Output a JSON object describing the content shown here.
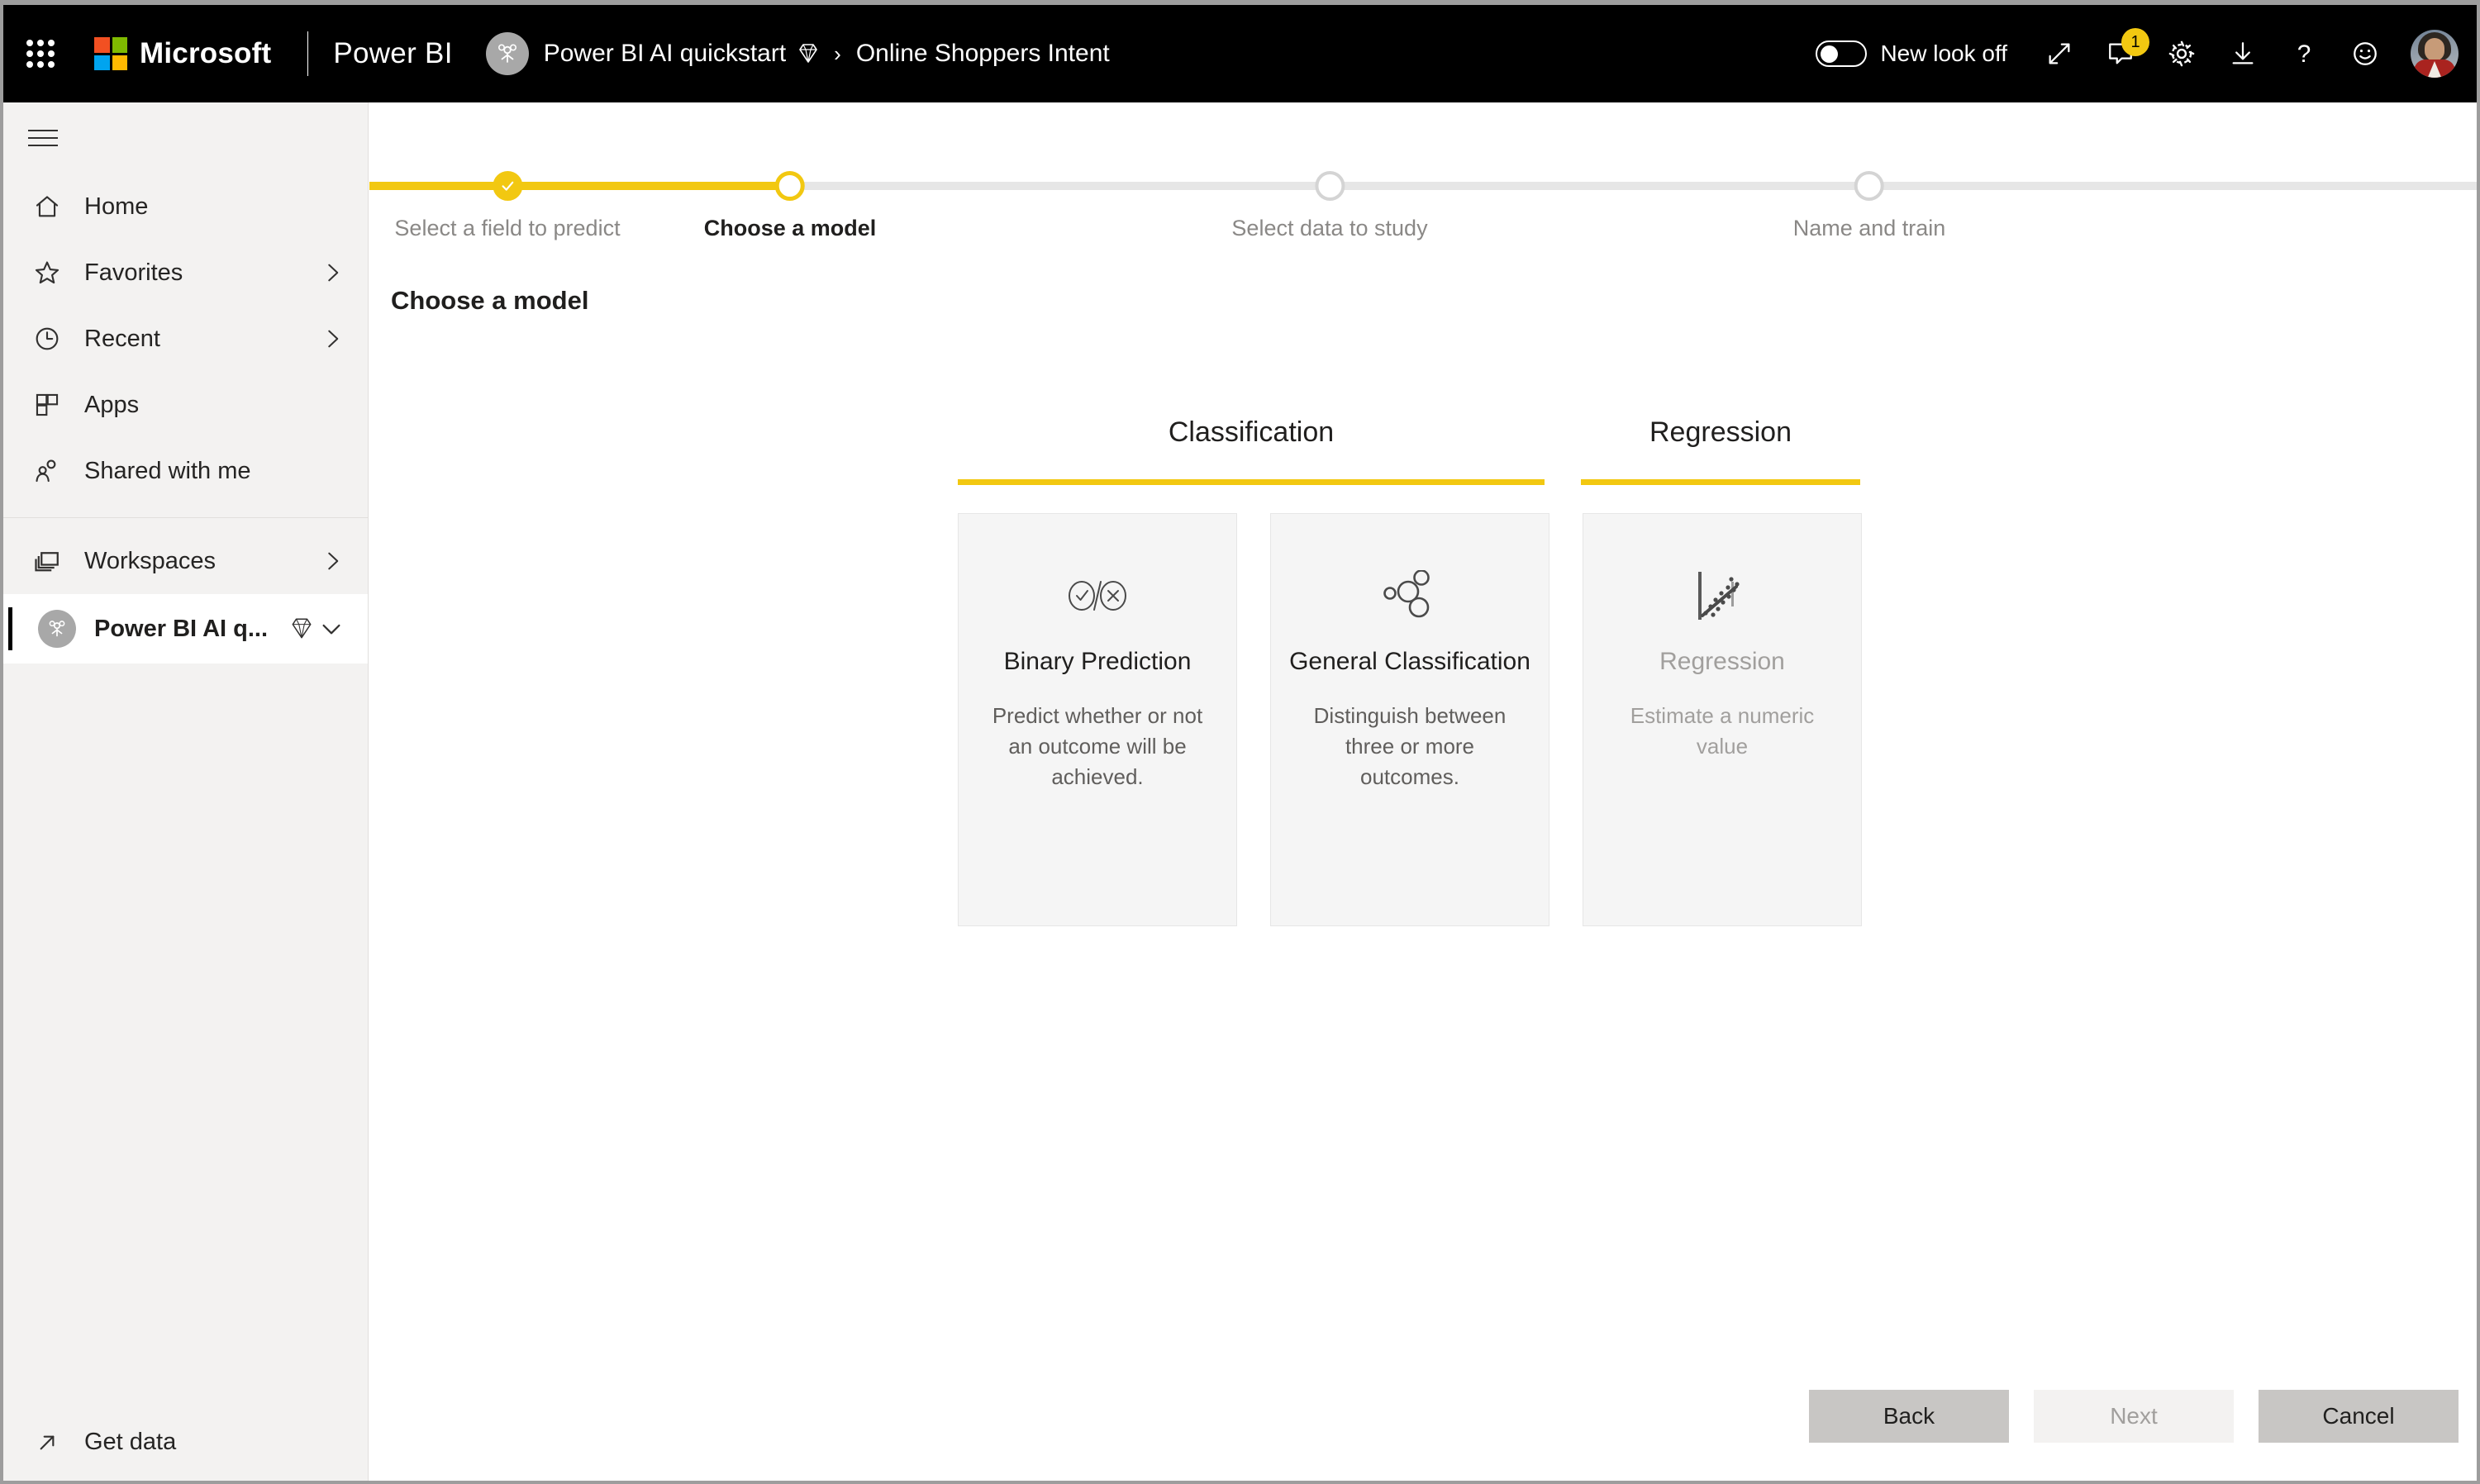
{
  "topbar": {
    "waffle_label": "app-launcher",
    "microsoft_label": "Microsoft",
    "product_label": "Power BI",
    "breadcrumb": {
      "workspace": "Power BI AI quickstart",
      "separator": "›",
      "current": "Online Shoppers Intent"
    },
    "new_look_label": "New look off",
    "new_look_state": "off",
    "notification_count": "1",
    "icons": [
      "expand-icon",
      "feedback-icon",
      "gear-icon",
      "download-icon",
      "help-icon",
      "smiley-icon"
    ]
  },
  "sidebar": {
    "items": [
      {
        "label": "Home",
        "icon": "home-icon",
        "chevron": false
      },
      {
        "label": "Favorites",
        "icon": "star-icon",
        "chevron": true
      },
      {
        "label": "Recent",
        "icon": "clock-icon",
        "chevron": true
      },
      {
        "label": "Apps",
        "icon": "apps-icon",
        "chevron": false
      },
      {
        "label": "Shared with me",
        "icon": "shared-people-icon",
        "chevron": false
      }
    ],
    "workspaces": {
      "label": "Workspaces",
      "icon": "workspaces-icon",
      "chevron": true
    },
    "active_workspace": {
      "label": "Power BI AI q...",
      "icon": "workspace-avatar-icon",
      "badge": "premium-gem-icon"
    },
    "get_data": {
      "label": "Get data",
      "icon": "arrow-up-right-icon"
    }
  },
  "main": {
    "page_title": "Choose a model",
    "steps": [
      {
        "label": "Select a field to predict",
        "state": "done"
      },
      {
        "label": "Choose a model",
        "state": "current"
      },
      {
        "label": "Select data to study",
        "state": "todo"
      },
      {
        "label": "Name and train",
        "state": "todo"
      }
    ],
    "categories": [
      {
        "name": "Classification"
      },
      {
        "name": "Regression"
      }
    ],
    "model_cards": [
      {
        "title": "Binary Prediction",
        "description": "Predict whether or not an outcome will be achieved.",
        "icon": "check-x-circles-icon",
        "enabled": true
      },
      {
        "title": "General Classification",
        "description": "Distinguish between three or more outcomes.",
        "icon": "bubbles-cluster-icon",
        "enabled": true
      },
      {
        "title": "Regression",
        "description": "Estimate a numeric value",
        "icon": "scatter-plot-icon",
        "enabled": false
      }
    ],
    "buttons": {
      "back": "Back",
      "next": "Next",
      "cancel": "Cancel"
    }
  },
  "colors": {
    "accent_yellow": "#f2c811",
    "topbar_black": "#000000",
    "sidebar_gray": "#f3f2f1",
    "card_gray": "#f5f5f5",
    "track_gray": "#e6e6e6"
  }
}
